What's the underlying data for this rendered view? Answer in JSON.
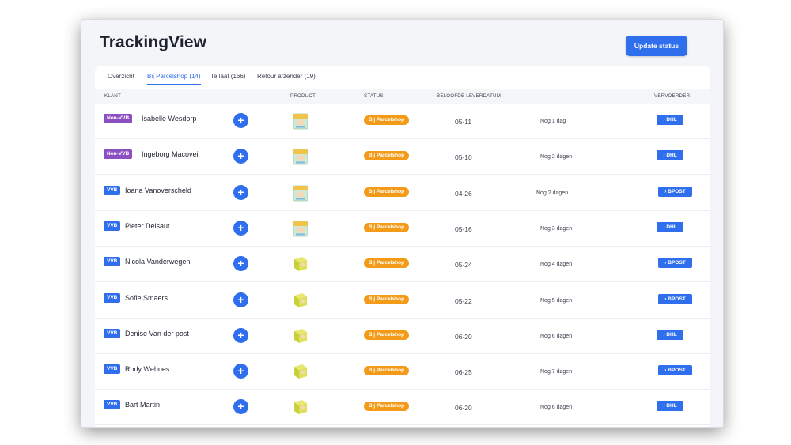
{
  "app": {
    "title": "TrackingView",
    "update_button": "Update status"
  },
  "tabs": [
    {
      "label": "Overzicht",
      "active": false
    },
    {
      "label": "Bij Parcelshop (14)",
      "active": true
    },
    {
      "label": "Te laat (166)",
      "active": false
    },
    {
      "label": "Retour afzender (19)",
      "active": false
    }
  ],
  "columns": {
    "klant": "KLANT",
    "product": "PRODUCT",
    "status": "STATUS",
    "leverdatum": "BELOOFDE LEVERDATUM",
    "vervoerder": "VERVOERDER"
  },
  "colors": {
    "accent": "#2f6fed",
    "non_vvb": "#8b4fc2",
    "vvb": "#2f6fed",
    "status_orange": "#f39a19"
  },
  "rows": [
    {
      "tag": "Non-VVB",
      "name": "Isabelle Wesdorp",
      "product_icon": "diaper-pack-icon",
      "status": "Bij Parcelshop",
      "date": "05-11",
      "days": "Nog 1 dag",
      "carrier": "DHL"
    },
    {
      "tag": "Non-VVB",
      "name": "Ingeborg Macovei",
      "product_icon": "diaper-pack-icon",
      "status": "Bij Parcelshop",
      "date": "05-10",
      "days": "Nog 2 dagen",
      "carrier": "DHL"
    },
    {
      "tag": "VVB",
      "name": "Ioana Vanoverscheld",
      "product_icon": "diaper-pack-icon",
      "status": "Bij Parcelshop",
      "date": "04-26",
      "days": "Nog 2 dagen",
      "carrier": "BPOST"
    },
    {
      "tag": "VVB",
      "name": "Pieter Delsaut",
      "product_icon": "diaper-pack-icon",
      "status": "Bij Parcelshop",
      "date": "05-16",
      "days": "Nog 3 dagen",
      "carrier": "DHL"
    },
    {
      "tag": "VVB",
      "name": "Nicola Vanderwegen",
      "product_icon": "product-box-icon",
      "status": "Bij Parcelshop",
      "date": "05-24",
      "days": "Nog 4 dagen",
      "carrier": "BPOST"
    },
    {
      "tag": "VVB",
      "name": "Sofie Smaers",
      "product_icon": "product-box-icon",
      "status": "Bij Parcelshop",
      "date": "05-22",
      "days": "Nog 5 dagen",
      "carrier": "BPOST"
    },
    {
      "tag": "VVB",
      "name": "Denise Van der post",
      "product_icon": "product-box-icon",
      "status": "Bij Parcelshop",
      "date": "06-20",
      "days": "Nog 6 dagen",
      "carrier": "DHL"
    },
    {
      "tag": "VVB",
      "name": "Rody Wehnes",
      "product_icon": "product-box-icon",
      "status": "Bij Parcelshop",
      "date": "06-25",
      "days": "Nog 7 dagen",
      "carrier": "BPOST"
    },
    {
      "tag": "VVB",
      "name": "Bart Martin",
      "product_icon": "product-box-icon",
      "status": "Bij Parcelshop",
      "date": "06-20",
      "days": "Nog 6 dagen",
      "carrier": "DHL"
    }
  ]
}
